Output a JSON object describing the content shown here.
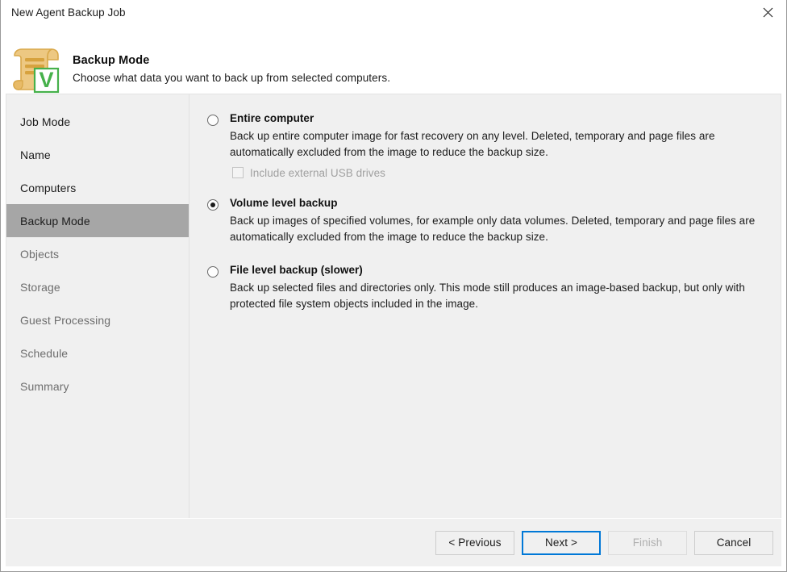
{
  "window": {
    "title": "New Agent Backup Job",
    "close_icon": "close-icon"
  },
  "header": {
    "icon": "backup-job-document-icon",
    "badge_letter": "V",
    "title": "Backup Mode",
    "subtitle": "Choose what data you want to back up from selected computers."
  },
  "sidebar": {
    "items": [
      {
        "label": "Job Mode",
        "state": "done"
      },
      {
        "label": "Name",
        "state": "done"
      },
      {
        "label": "Computers",
        "state": "done"
      },
      {
        "label": "Backup Mode",
        "state": "active"
      },
      {
        "label": "Objects",
        "state": "pending"
      },
      {
        "label": "Storage",
        "state": "pending"
      },
      {
        "label": "Guest Processing",
        "state": "pending"
      },
      {
        "label": "Schedule",
        "state": "pending"
      },
      {
        "label": "Summary",
        "state": "pending"
      }
    ]
  },
  "main": {
    "options": [
      {
        "title": "Entire computer",
        "description": "Back up entire computer image for fast recovery on any level. Deleted, temporary and page files are automatically excluded from the image to reduce the backup size.",
        "selected": false,
        "suboption": {
          "label": "Include external USB drives",
          "checked": false,
          "disabled": true
        }
      },
      {
        "title": "Volume level backup",
        "description": "Back up images of specified volumes, for example only data volumes. Deleted, temporary and page files are automatically excluded from the image to reduce the backup size.",
        "selected": true
      },
      {
        "title": "File level backup (slower)",
        "description": "Back up selected files and directories only. This mode still produces an image-based backup, but only with protected file system objects included in the image.",
        "selected": false
      }
    ]
  },
  "footer": {
    "buttons": [
      {
        "label": "< Previous",
        "state": "normal"
      },
      {
        "label": "Next >",
        "state": "focused"
      },
      {
        "label": "Finish",
        "state": "disabled"
      },
      {
        "label": "Cancel",
        "state": "normal"
      }
    ]
  },
  "colors": {
    "accent": "#0078d7",
    "sidebar_bg": "#f0f0f0",
    "active_nav_bg": "#a6a6a6",
    "badge_green": "#3faa3f",
    "icon_gold": "#e8b84b"
  }
}
